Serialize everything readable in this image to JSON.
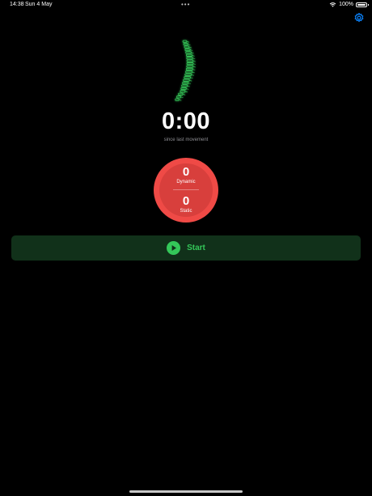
{
  "status_bar": {
    "time": "14:38",
    "date": "Sun 4 May",
    "battery_text": "100%",
    "battery_level": 1.0,
    "icons": [
      "wifi-icon",
      "battery-icon"
    ]
  },
  "toolbar": {
    "settings_icon": "gear-icon"
  },
  "hero": {
    "image": "spine-illustration"
  },
  "timer": {
    "value": "0:00",
    "caption": "since last movement"
  },
  "counters": {
    "dynamic_value": "0",
    "dynamic_label": "Dynamic",
    "static_value": "0",
    "static_label": "Static"
  },
  "start_button": {
    "label": "Start",
    "icon": "play-icon"
  },
  "colors": {
    "background": "#000000",
    "accent_green": "#34c759",
    "button_background": "#11311a",
    "counter_red": "#ef4a46",
    "settings_blue": "#0a84ff",
    "caption_gray": "#8e8e93"
  }
}
